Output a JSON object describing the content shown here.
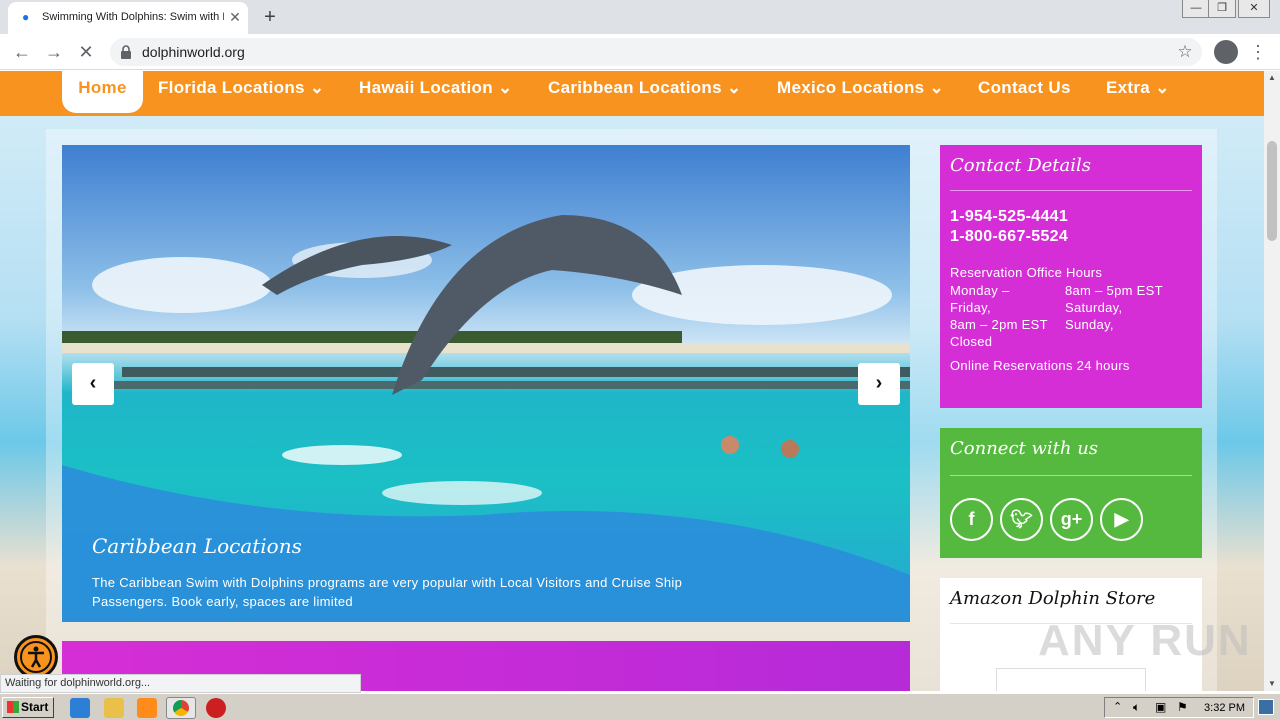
{
  "browser": {
    "tab_title": "Swimming With Dolphins: Swim with D",
    "url": "dolphinworld.org",
    "status_text": "Waiting for dolphinworld.org..."
  },
  "nav": {
    "home": "Home",
    "items": [
      "Florida Locations",
      "Hawaii Location",
      "Caribbean Locations",
      "Mexico Locations",
      "Contact Us",
      "Extra"
    ]
  },
  "slider": {
    "title": "Caribbean Locations",
    "text": "The Caribbean Swim with Dolphins programs are very popular with Local Visitors and Cruise Ship Passengers. Book early, spaces are limited"
  },
  "contact": {
    "title": "Contact Details",
    "phones": [
      "1-954-525-4441",
      "1-800-667-5524"
    ],
    "hours_label": "Reservation Office Hours",
    "hours_col1": [
      "Monday –",
      "Friday,",
      "8am – 2pm EST",
      "Closed"
    ],
    "hours_col2": [
      "8am – 5pm EST",
      "Saturday,",
      "Sunday,"
    ],
    "online": "Online Reservations 24 hours"
  },
  "connect": {
    "title": "Connect with us",
    "icons": [
      "facebook-icon",
      "twitter-icon",
      "google-plus-icon",
      "youtube-icon"
    ]
  },
  "amazon": {
    "title": "Amazon Dolphin Store"
  },
  "watermark": "ANY RUN",
  "taskbar": {
    "start": "Start",
    "clock": "3:32 PM"
  },
  "colors": {
    "nav_orange": "#f7931e",
    "contact_magenta": "#d62ed6",
    "connect_green": "#56b93f"
  }
}
